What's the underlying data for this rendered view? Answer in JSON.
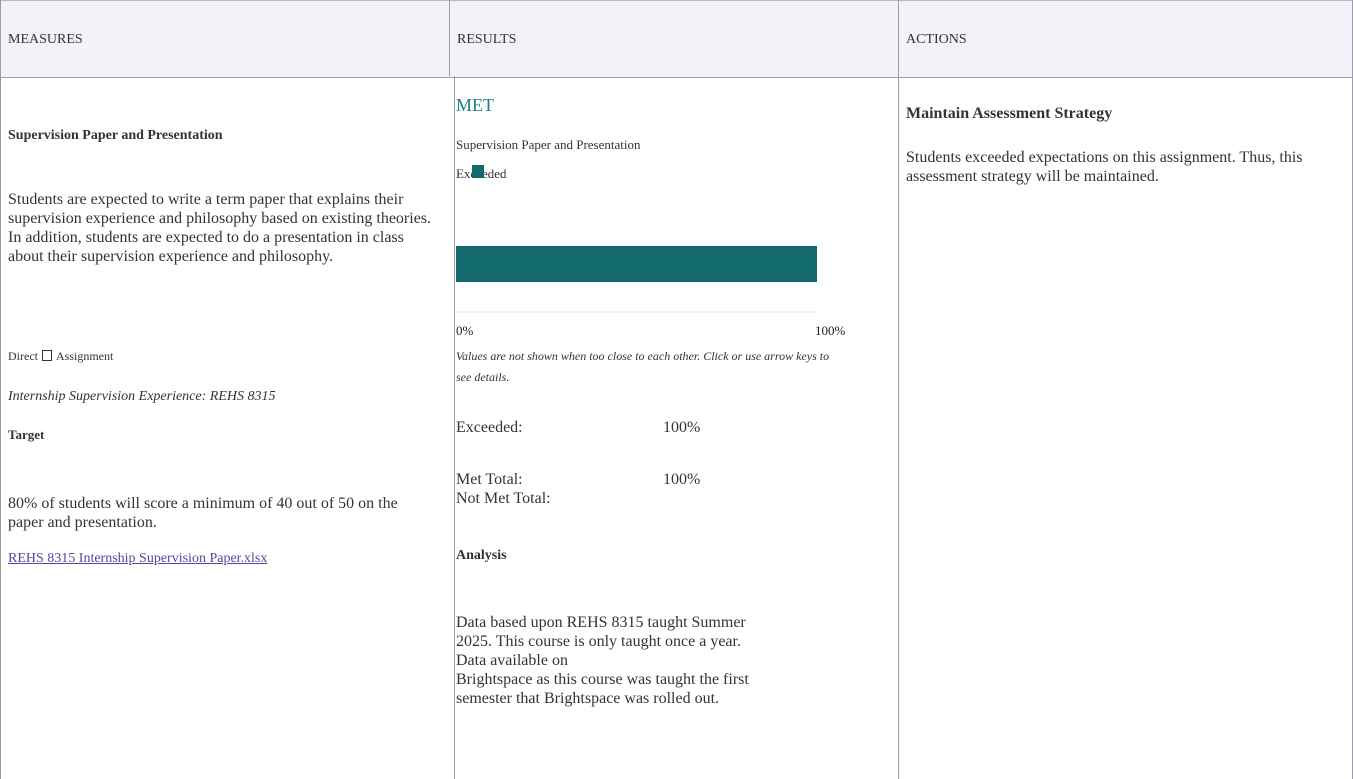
{
  "headers": {
    "measures": "MEASURES",
    "results": "RESULTS",
    "actions": "ACTIONS"
  },
  "measures": {
    "title": "Supervision Paper and Presentation",
    "description": "Students are expected to write a term paper that explains their supervision experience and philosophy based on existing theories. In addition, students are expected to do a presentation in class about their supervision experience and philosophy.",
    "type_left": "Direct",
    "type_right": "Assignment",
    "course": "Internship Supervision Experience: REHS  8315",
    "target_heading": "Target",
    "target_text": "80% of students will score a minimum of 40 out of 50 on the paper and presentation.",
    "attachment_link": "REHS  8315  Internship  Supervision  Paper.xlsx"
  },
  "results": {
    "status": "MET",
    "measure_name": "Supervision Paper and Presentation",
    "legend_label": "Exceeded",
    "chart_note": "Values are not shown when too close to each other.  Click or use arrow keys to see details.",
    "stats": [
      {
        "label": "Exceeded:",
        "value": "100%"
      },
      {
        "label": "Met Total:",
        "value": "100%"
      },
      {
        "label": "Not Met Total:",
        "value": ""
      }
    ],
    "analysis_heading": "Analysis",
    "analysis_lines": [
      "Data based upon REHS 8315 taught Summer",
      "2025. This course is only taught once a year.",
      "Data available on",
      "Brightspace as this course was taught the first",
      "semester that Brightspace was rolled out."
    ]
  },
  "actions": {
    "title": "Maintain  Assessment  Strategy",
    "text": "Students exceeded expectations on this assignment. Thus, this assessment strategy will be maintained."
  },
  "chart_data": {
    "type": "bar",
    "categories": [
      "Exceeded"
    ],
    "values": [
      100
    ],
    "xlim": [
      0,
      100
    ],
    "tick_labels": [
      "0%",
      "100%"
    ],
    "bar_color": "#136a6e"
  },
  "colors": {
    "header_bg": "#f3f2f8",
    "met": "#1a7f86",
    "link": "#4b4c9c",
    "bar": "#136a6e"
  }
}
